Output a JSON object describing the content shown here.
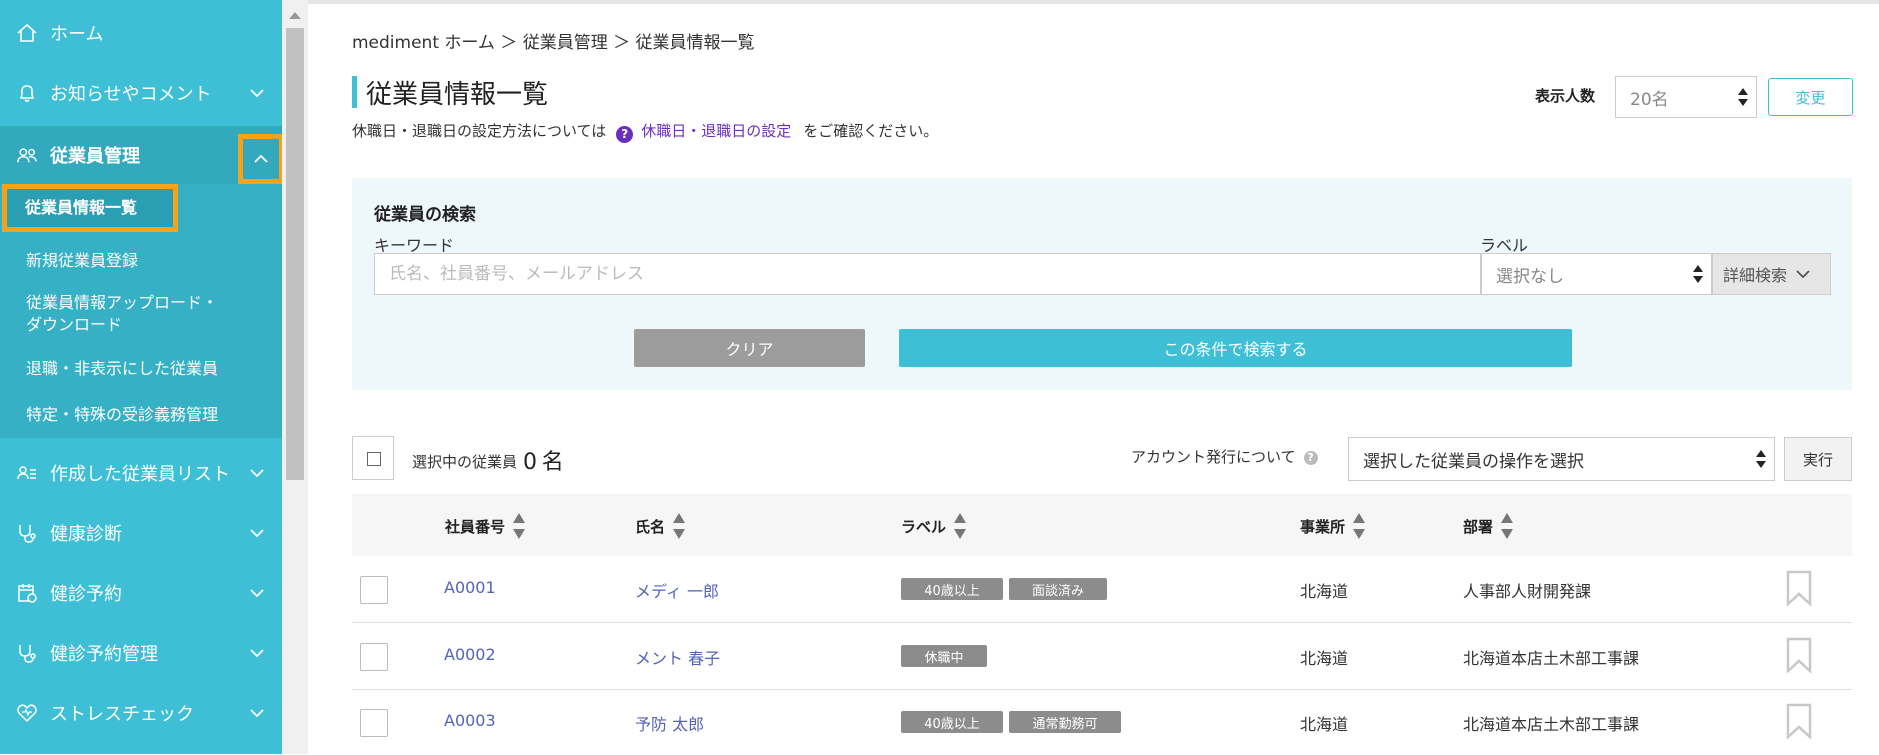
{
  "sidebar": {
    "items": [
      {
        "label": "ホーム",
        "icon": "home-icon"
      },
      {
        "label": "お知らせやコメント",
        "icon": "bell-icon"
      },
      {
        "label": "従業員管理",
        "icon": "people-icon"
      },
      {
        "label": "作成した従業員リスト",
        "icon": "person-list-icon"
      },
      {
        "label": "健康診断",
        "icon": "stethoscope-icon"
      },
      {
        "label": "健診予約",
        "icon": "calendar-icon"
      },
      {
        "label": "健診予約管理",
        "icon": "stethoscope-icon"
      },
      {
        "label": "ストレスチェック",
        "icon": "heart-icon"
      }
    ],
    "submenu": [
      "従業員情報一覧",
      "新規従業員登録",
      "従業員情報アップロード・",
      "ダウンロード",
      "退職・非表示にした従業員",
      "特定・特殊の受診義務管理"
    ]
  },
  "breadcrumb": "mediment ホーム ＞ 従業員管理 ＞ 従業員情報一覧",
  "page_title": "従業員情報一覧",
  "info": {
    "prefix": "休職日・退職日の設定方法については",
    "link": "休職日・退職日の設定",
    "suffix": "をご確認ください。"
  },
  "display_count": {
    "label": "表示人数",
    "value": "20名",
    "button": "変更"
  },
  "search": {
    "title": "従業員の検索",
    "keyword_label": "キーワード",
    "keyword_placeholder": "氏名、社員番号、メールアドレス",
    "label_label": "ラベル",
    "label_value": "選択なし",
    "detail_search": "詳細検索",
    "clear_button": "クリア",
    "search_button": "この条件で検索する"
  },
  "selection": {
    "label": "選択中の従業員",
    "count": "0",
    "unit": "名",
    "account_label": "アカウント発行について",
    "action_placeholder": "選択した従業員の操作を選択",
    "run_button": "実行"
  },
  "table": {
    "headers": [
      "社員番号",
      "氏名",
      "ラベル",
      "事業所",
      "部署"
    ],
    "rows": [
      {
        "id": "A0001",
        "name": "メディ 一郎",
        "tags": [
          "40歳以上",
          "面談済み"
        ],
        "office": "北海道",
        "dept": "人事部人財開発課"
      },
      {
        "id": "A0002",
        "name": "メント 春子",
        "tags": [
          "休職中"
        ],
        "office": "北海道",
        "dept": "北海道本店土木部工事課"
      },
      {
        "id": "A0003",
        "name": "予防 太郎",
        "tags": [
          "40歳以上",
          "通常勤務可"
        ],
        "office": "北海道",
        "dept": "北海道本店土木部工事課"
      }
    ]
  },
  "colors": {
    "accent": "#3ebfd6",
    "highlight": "#f5a31a",
    "link": "#5563b8",
    "tag": "#8c8c8c"
  }
}
